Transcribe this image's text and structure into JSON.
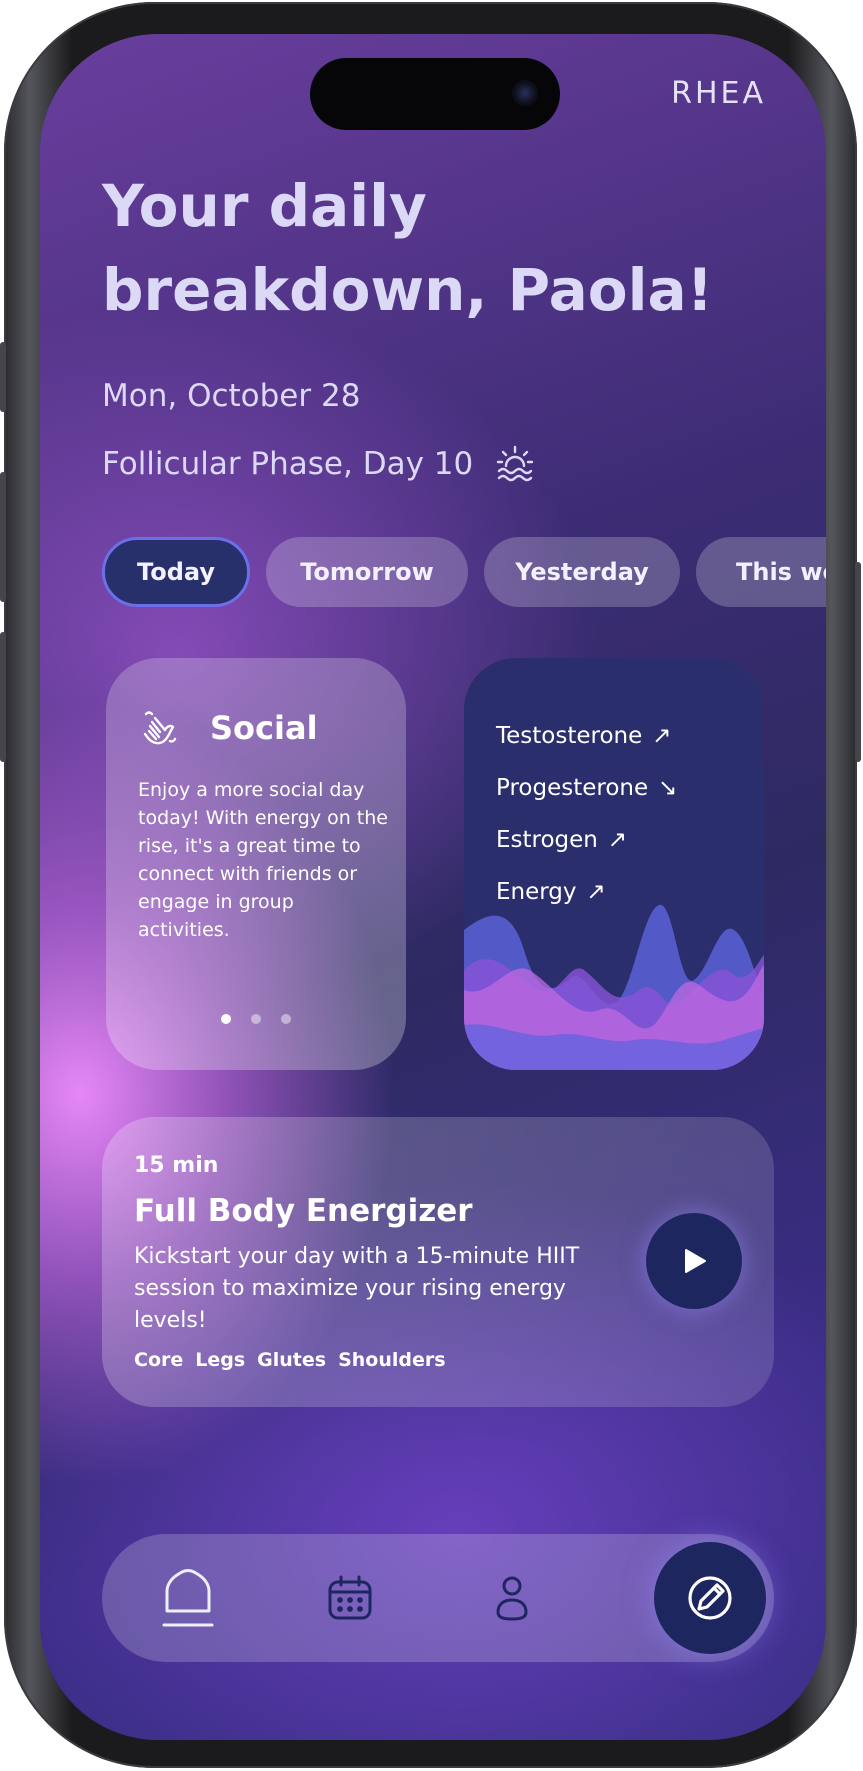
{
  "app": {
    "logo": "RHEA"
  },
  "header": {
    "title": "Your daily breakdown, Paola!",
    "date": "Mon, October 28",
    "phase": "Follicular Phase, Day 10",
    "phase_icon": "sunrise-icon"
  },
  "tabs": [
    {
      "label": "Today",
      "selected": true
    },
    {
      "label": "Tomorrow",
      "selected": false
    },
    {
      "label": "Yesterday",
      "selected": false
    },
    {
      "label": "This wee",
      "selected": false
    }
  ],
  "social_card": {
    "icon": "waving-hand-icon",
    "title": "Social",
    "body": "Enjoy a more social day today! With energy on the rise, it's a great time to connect with friends or engage in group activities.",
    "page_count": 3,
    "active_page": 1
  },
  "hormones_card": {
    "items": [
      {
        "name": "Testosterone",
        "trend": "up",
        "arrow": "↗"
      },
      {
        "name": "Progesterone",
        "trend": "down",
        "arrow": "↘"
      },
      {
        "name": "Estrogen",
        "trend": "up",
        "arrow": "↗"
      },
      {
        "name": "Energy",
        "trend": "up",
        "arrow": "↗"
      }
    ]
  },
  "workout": {
    "duration": "15 min",
    "title": "Full Body Energizer",
    "description": "Kickstart your day with a 15-minute HIIT session to maximize your rising energy levels!",
    "tags": [
      "Core",
      "Legs",
      "Glutes",
      "Shoulders"
    ],
    "play_icon": "play-icon"
  },
  "bottom_nav": {
    "items": [
      {
        "icon": "home-icon",
        "active": true
      },
      {
        "icon": "calendar-icon",
        "active": false
      },
      {
        "icon": "profile-icon",
        "active": false
      }
    ],
    "action_icon": "edit-icon"
  },
  "colors": {
    "accent_dark": "#1e2660",
    "selected_border": "#6b6fe8",
    "text_light": "#dcd9f6"
  }
}
